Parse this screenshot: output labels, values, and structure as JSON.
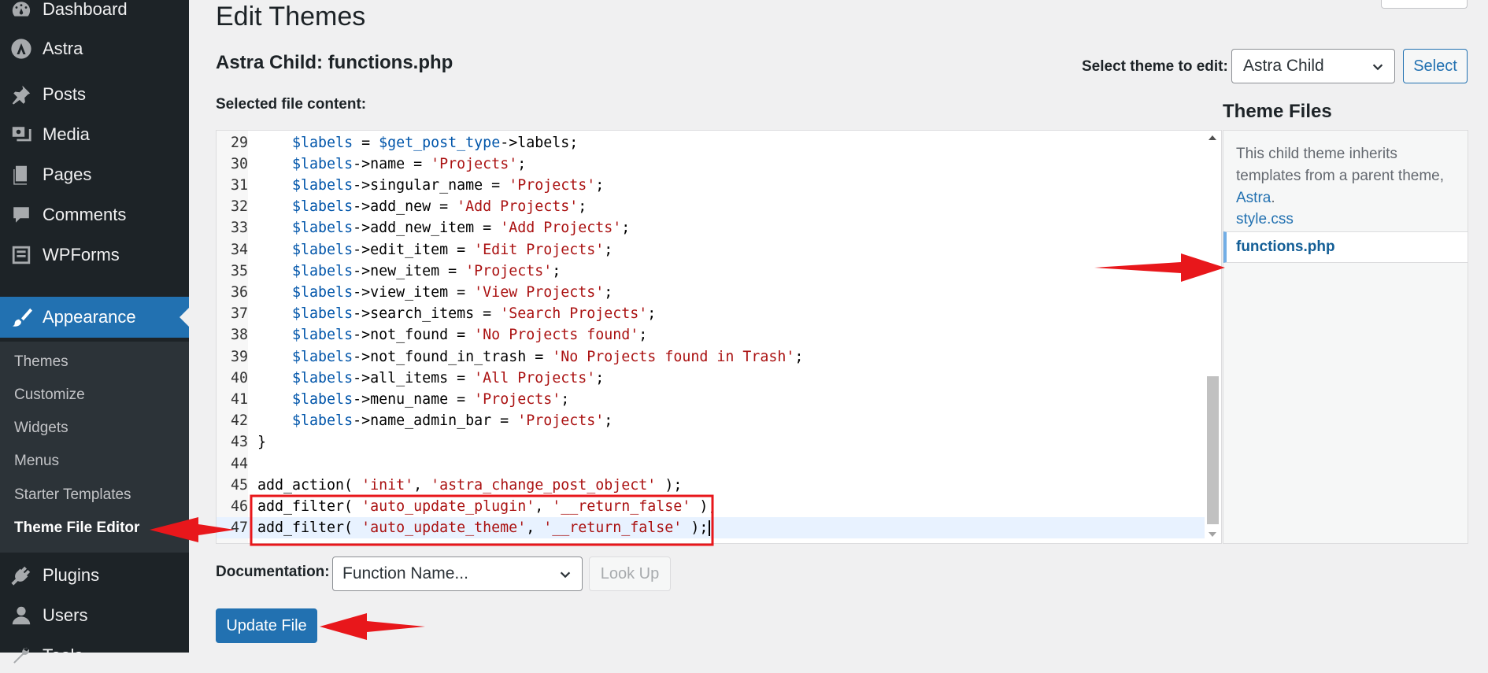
{
  "sidebar": {
    "items": [
      {
        "label": "Dashboard",
        "icon": "dashboard-icon"
      },
      {
        "label": "Astra",
        "icon": "astra-icon"
      },
      {
        "label": "Posts",
        "icon": "pin-icon"
      },
      {
        "label": "Media",
        "icon": "media-icon"
      },
      {
        "label": "Pages",
        "icon": "pages-icon"
      },
      {
        "label": "Comments",
        "icon": "comments-icon"
      },
      {
        "label": "WPForms",
        "icon": "wpforms-icon"
      },
      {
        "label": "Appearance",
        "icon": "brush-icon"
      },
      {
        "label": "Plugins",
        "icon": "plugin-icon"
      },
      {
        "label": "Users",
        "icon": "users-icon"
      },
      {
        "label": "Tools",
        "icon": "tools-icon"
      }
    ],
    "submenu": [
      "Themes",
      "Customize",
      "Widgets",
      "Menus",
      "Starter Templates",
      "Theme File Editor"
    ],
    "current_submenu": "Theme File Editor",
    "colors": {
      "background": "#1d2327",
      "active": "#2271b1",
      "submenu": "#2c3338"
    }
  },
  "page": {
    "title": "Edit Themes",
    "file_title": "Astra Child: functions.php",
    "select_theme_label": "Select theme to edit:",
    "selected_theme": "Astra Child",
    "select_button": "Select",
    "content_label": "Selected file content:"
  },
  "editor": {
    "lines": [
      {
        "n": "29",
        "tokens": [
          [
            "",
            "    "
          ],
          [
            "var",
            "$labels"
          ],
          [
            "",
            " = "
          ],
          [
            "var",
            "$get_post_type"
          ],
          [
            "",
            "->labels;"
          ]
        ]
      },
      {
        "n": "30",
        "tokens": [
          [
            "",
            "    "
          ],
          [
            "var",
            "$labels"
          ],
          [
            "",
            "->name = "
          ],
          [
            "str",
            "'Projects'"
          ],
          [
            "",
            ";"
          ]
        ]
      },
      {
        "n": "31",
        "tokens": [
          [
            "",
            "    "
          ],
          [
            "var",
            "$labels"
          ],
          [
            "",
            "->singular_name = "
          ],
          [
            "str",
            "'Projects'"
          ],
          [
            "",
            ";"
          ]
        ]
      },
      {
        "n": "32",
        "tokens": [
          [
            "",
            "    "
          ],
          [
            "var",
            "$labels"
          ],
          [
            "",
            "->add_new = "
          ],
          [
            "str",
            "'Add Projects'"
          ],
          [
            "",
            ";"
          ]
        ]
      },
      {
        "n": "33",
        "tokens": [
          [
            "",
            "    "
          ],
          [
            "var",
            "$labels"
          ],
          [
            "",
            "->add_new_item = "
          ],
          [
            "str",
            "'Add Projects'"
          ],
          [
            "",
            ";"
          ]
        ]
      },
      {
        "n": "34",
        "tokens": [
          [
            "",
            "    "
          ],
          [
            "var",
            "$labels"
          ],
          [
            "",
            "->edit_item = "
          ],
          [
            "str",
            "'Edit Projects'"
          ],
          [
            "",
            ";"
          ]
        ]
      },
      {
        "n": "35",
        "tokens": [
          [
            "",
            "    "
          ],
          [
            "var",
            "$labels"
          ],
          [
            "",
            "->new_item = "
          ],
          [
            "str",
            "'Projects'"
          ],
          [
            "",
            ";"
          ]
        ]
      },
      {
        "n": "36",
        "tokens": [
          [
            "",
            "    "
          ],
          [
            "var",
            "$labels"
          ],
          [
            "",
            "->view_item = "
          ],
          [
            "str",
            "'View Projects'"
          ],
          [
            "",
            ";"
          ]
        ]
      },
      {
        "n": "37",
        "tokens": [
          [
            "",
            "    "
          ],
          [
            "var",
            "$labels"
          ],
          [
            "",
            "->search_items = "
          ],
          [
            "str",
            "'Search Projects'"
          ],
          [
            "",
            ";"
          ]
        ]
      },
      {
        "n": "38",
        "tokens": [
          [
            "",
            "    "
          ],
          [
            "var",
            "$labels"
          ],
          [
            "",
            "->not_found = "
          ],
          [
            "str",
            "'No Projects found'"
          ],
          [
            "",
            ";"
          ]
        ]
      },
      {
        "n": "39",
        "tokens": [
          [
            "",
            "    "
          ],
          [
            "var",
            "$labels"
          ],
          [
            "",
            "->not_found_in_trash = "
          ],
          [
            "str",
            "'No Projects found in Trash'"
          ],
          [
            "",
            ";"
          ]
        ]
      },
      {
        "n": "40",
        "tokens": [
          [
            "",
            "    "
          ],
          [
            "var",
            "$labels"
          ],
          [
            "",
            "->all_items = "
          ],
          [
            "str",
            "'All Projects'"
          ],
          [
            "",
            ";"
          ]
        ]
      },
      {
        "n": "41",
        "tokens": [
          [
            "",
            "    "
          ],
          [
            "var",
            "$labels"
          ],
          [
            "",
            "->menu_name = "
          ],
          [
            "str",
            "'Projects'"
          ],
          [
            "",
            ";"
          ]
        ]
      },
      {
        "n": "42",
        "tokens": [
          [
            "",
            "    "
          ],
          [
            "var",
            "$labels"
          ],
          [
            "",
            "->name_admin_bar = "
          ],
          [
            "str",
            "'Projects'"
          ],
          [
            "",
            ";"
          ]
        ]
      },
      {
        "n": "43",
        "tokens": [
          [
            "",
            "}"
          ]
        ]
      },
      {
        "n": "44",
        "tokens": []
      },
      {
        "n": "45",
        "tokens": [
          [
            "",
            "add_action( "
          ],
          [
            "str",
            "'init'"
          ],
          [
            "",
            ", "
          ],
          [
            "str",
            "'astra_change_post_object'"
          ],
          [
            "",
            " );"
          ]
        ]
      },
      {
        "n": "46",
        "tokens": [
          [
            "",
            "add_filter( "
          ],
          [
            "str",
            "'auto_update_plugin'"
          ],
          [
            "",
            ", "
          ],
          [
            "str",
            "'__return_false'"
          ],
          [
            "",
            " );"
          ]
        ]
      },
      {
        "n": "47",
        "tokens": [
          [
            "",
            "add_filter( "
          ],
          [
            "str",
            "'auto_update_theme'"
          ],
          [
            "",
            ", "
          ],
          [
            "str",
            "'__return_false'"
          ],
          [
            "",
            " );"
          ]
        ]
      }
    ],
    "current_line": "47",
    "colors": {
      "variable": "#0055aa",
      "string": "#aa1111",
      "text": "#000000"
    }
  },
  "theme_files": {
    "heading": "Theme Files",
    "note": "This child theme inherits templates from a parent theme,",
    "parent_link": "Astra",
    "note_end": ".",
    "files": [
      "style.css",
      "functions.php"
    ],
    "current_file": "functions.php"
  },
  "documentation": {
    "label": "Documentation:",
    "select_placeholder": "Function Name...",
    "lookup_button": "Look Up"
  },
  "update_button": "Update File",
  "annotation_color": "#e8171b"
}
